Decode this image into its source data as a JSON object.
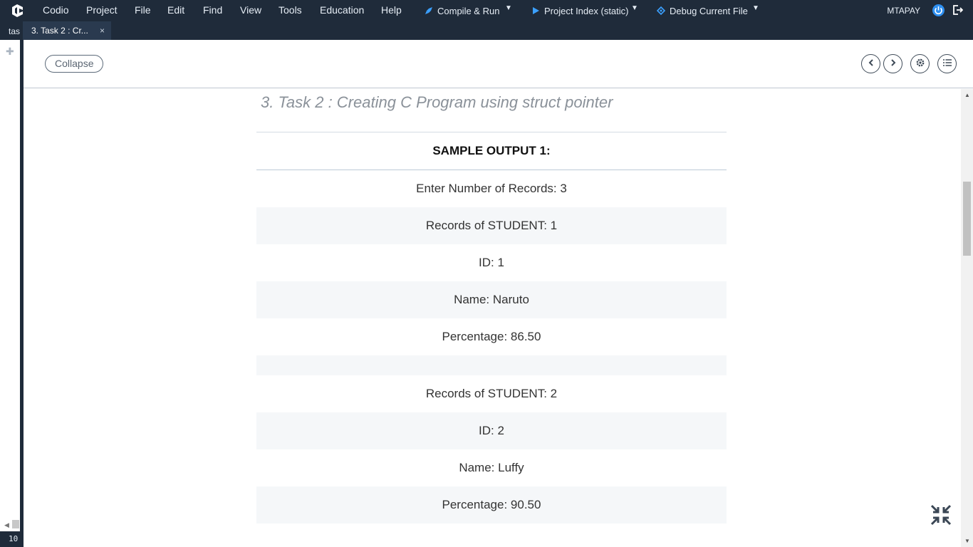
{
  "menubar": {
    "items": [
      "Codio",
      "Project",
      "File",
      "Edit",
      "Find",
      "View",
      "Tools",
      "Education",
      "Help"
    ],
    "compile_run": "Compile & Run",
    "project_index": "Project Index (static)",
    "debug_current": "Debug Current File",
    "user": "MTAPAY"
  },
  "left_strip": {
    "tab_label": "tas",
    "status_text": "10"
  },
  "tabbar": {
    "active_tab": "3. Task 2 : Cr...",
    "close_glyph": "×"
  },
  "toolbar": {
    "collapse_label": "Collapse"
  },
  "content": {
    "heading": "3. Task 2 : Creating C Program using struct pointer",
    "sample_title": "SAMPLE OUTPUT 1:",
    "rows": [
      "Enter Number of Records: 3",
      "Records of STUDENT: 1",
      "ID: 1",
      "Name: Naruto",
      "Percentage: 86.50",
      "",
      "Records of STUDENT: 2",
      "ID: 2",
      "Name: Luffy",
      "Percentage: 90.50"
    ]
  },
  "colors": {
    "menubar_bg": "#1f2b3a",
    "accent": "#2e8ff0",
    "row_alt": "#f5f7f9"
  }
}
